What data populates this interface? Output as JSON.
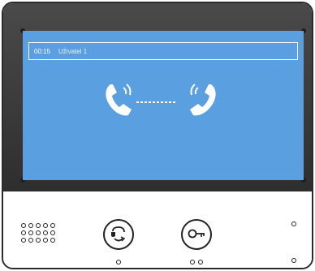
{
  "call_screen": {
    "duration": "00:15",
    "caller": "Uživatel 1"
  },
  "colors": {
    "bezel": "#3a3a3a",
    "screen": "#5aa0e0",
    "icon": "#ffffff"
  },
  "icons": {
    "left_phone": "phone-ringing-icon",
    "right_phone": "phone-ringing-icon",
    "talk_button": "talk-icon",
    "unlock_button": "key-icon"
  }
}
